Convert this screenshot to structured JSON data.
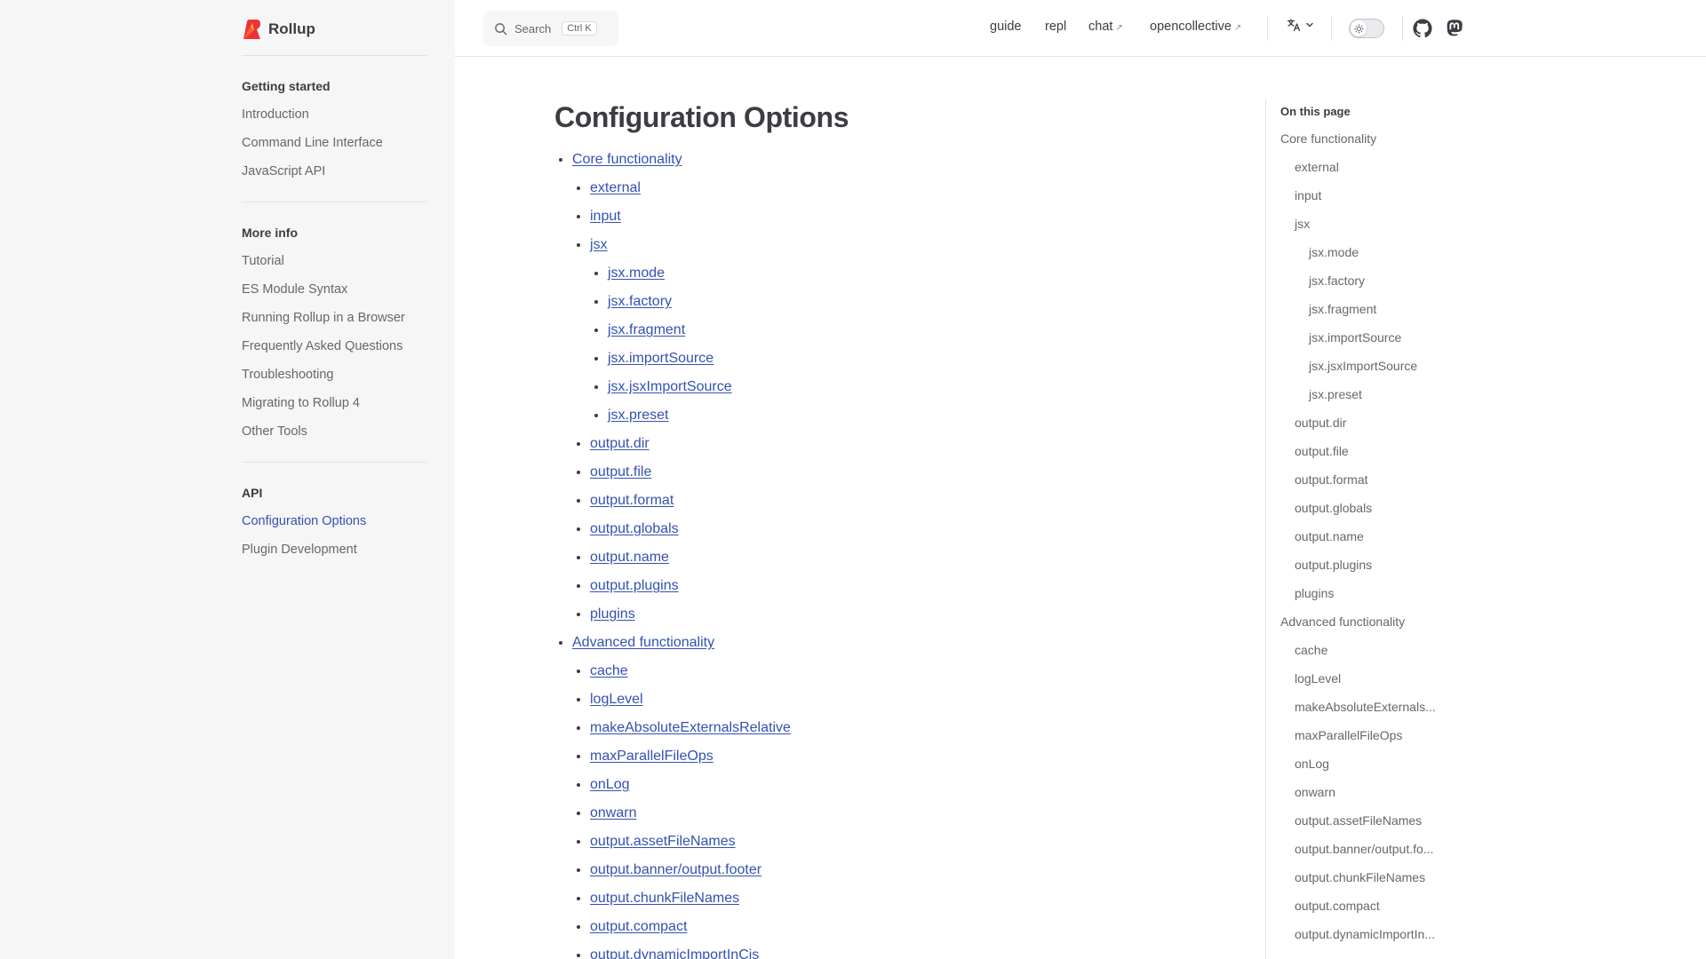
{
  "brand": {
    "name": "Rollup",
    "logo_icon": "rollup-logo-icon"
  },
  "sidebar": {
    "groups": [
      {
        "title": "Getting started",
        "items": [
          "Introduction",
          "Command Line Interface",
          "JavaScript API"
        ]
      },
      {
        "title": "More info",
        "items": [
          "Tutorial",
          "ES Module Syntax",
          "Running Rollup in a Browser",
          "Frequently Asked Questions",
          "Troubleshooting",
          "Migrating to Rollup 4",
          "Other Tools"
        ]
      },
      {
        "title": "API",
        "items": [
          "Configuration Options",
          "Plugin Development"
        ]
      }
    ],
    "active_item": "Configuration Options"
  },
  "topbar": {
    "search_label": "Search",
    "search_kbd": "Ctrl K",
    "links": {
      "guide": "guide",
      "repl": "repl",
      "chat": "chat",
      "opencollective": "opencollective"
    },
    "external_arrow": "↗",
    "icons": {
      "search": "search-icon",
      "translate": "translate-icon",
      "theme": "sun-icon",
      "github": "github-icon",
      "mastodon": "mastodon-icon"
    }
  },
  "main": {
    "title": "Configuration Options",
    "toc": [
      {
        "level": 1,
        "text": "Core functionality"
      },
      {
        "level": 2,
        "text": "external"
      },
      {
        "level": 2,
        "text": "input"
      },
      {
        "level": 2,
        "text": "jsx"
      },
      {
        "level": 3,
        "text": "jsx.mode"
      },
      {
        "level": 3,
        "text": "jsx.factory"
      },
      {
        "level": 3,
        "text": "jsx.fragment"
      },
      {
        "level": 3,
        "text": "jsx.importSource"
      },
      {
        "level": 3,
        "text": "jsx.jsxImportSource"
      },
      {
        "level": 3,
        "text": "jsx.preset"
      },
      {
        "level": 2,
        "text": "output.dir"
      },
      {
        "level": 2,
        "text": "output.file"
      },
      {
        "level": 2,
        "text": "output.format"
      },
      {
        "level": 2,
        "text": "output.globals"
      },
      {
        "level": 2,
        "text": "output.name"
      },
      {
        "level": 2,
        "text": "output.plugins"
      },
      {
        "level": 2,
        "text": "plugins"
      },
      {
        "level": 1,
        "text": "Advanced functionality"
      },
      {
        "level": 2,
        "text": "cache"
      },
      {
        "level": 2,
        "text": "logLevel"
      },
      {
        "level": 2,
        "text": "makeAbsoluteExternalsRelative"
      },
      {
        "level": 2,
        "text": "maxParallelFileOps"
      },
      {
        "level": 2,
        "text": "onLog"
      },
      {
        "level": 2,
        "text": "onwarn"
      },
      {
        "level": 2,
        "text": "output.assetFileNames"
      },
      {
        "level": 2,
        "text": "output.banner/output.footer"
      },
      {
        "level": 2,
        "text": "output.chunkFileNames"
      },
      {
        "level": 2,
        "text": "output.compact"
      },
      {
        "level": 2,
        "text": "output.dynamicImportInCjs"
      }
    ]
  },
  "aside": {
    "title": "On this page",
    "items": [
      {
        "level": 1,
        "text": "Core functionality"
      },
      {
        "level": 2,
        "text": "external"
      },
      {
        "level": 2,
        "text": "input"
      },
      {
        "level": 2,
        "text": "jsx"
      },
      {
        "level": 3,
        "text": "jsx.mode"
      },
      {
        "level": 3,
        "text": "jsx.factory"
      },
      {
        "level": 3,
        "text": "jsx.fragment"
      },
      {
        "level": 3,
        "text": "jsx.importSource"
      },
      {
        "level": 3,
        "text": "jsx.jsxImportSource"
      },
      {
        "level": 3,
        "text": "jsx.preset"
      },
      {
        "level": 2,
        "text": "output.dir"
      },
      {
        "level": 2,
        "text": "output.file"
      },
      {
        "level": 2,
        "text": "output.format"
      },
      {
        "level": 2,
        "text": "output.globals"
      },
      {
        "level": 2,
        "text": "output.name"
      },
      {
        "level": 2,
        "text": "output.plugins"
      },
      {
        "level": 2,
        "text": "plugins"
      },
      {
        "level": 1,
        "text": "Advanced functionality"
      },
      {
        "level": 2,
        "text": "cache"
      },
      {
        "level": 2,
        "text": "logLevel"
      },
      {
        "level": 2,
        "text": "makeAbsoluteExternals..."
      },
      {
        "level": 2,
        "text": "maxParallelFileOps"
      },
      {
        "level": 2,
        "text": "onLog"
      },
      {
        "level": 2,
        "text": "onwarn"
      },
      {
        "level": 2,
        "text": "output.assetFileNames"
      },
      {
        "level": 2,
        "text": "output.banner/output.fo..."
      },
      {
        "level": 2,
        "text": "output.chunkFileNames"
      },
      {
        "level": 2,
        "text": "output.compact"
      },
      {
        "level": 2,
        "text": "output.dynamicImportIn..."
      }
    ]
  },
  "colors": {
    "accent": "#3451b2",
    "sidebar_bg": "#f6f6f7",
    "text": "#3c3c43",
    "muted": "#67676c",
    "divider": "#e2e2e3"
  }
}
